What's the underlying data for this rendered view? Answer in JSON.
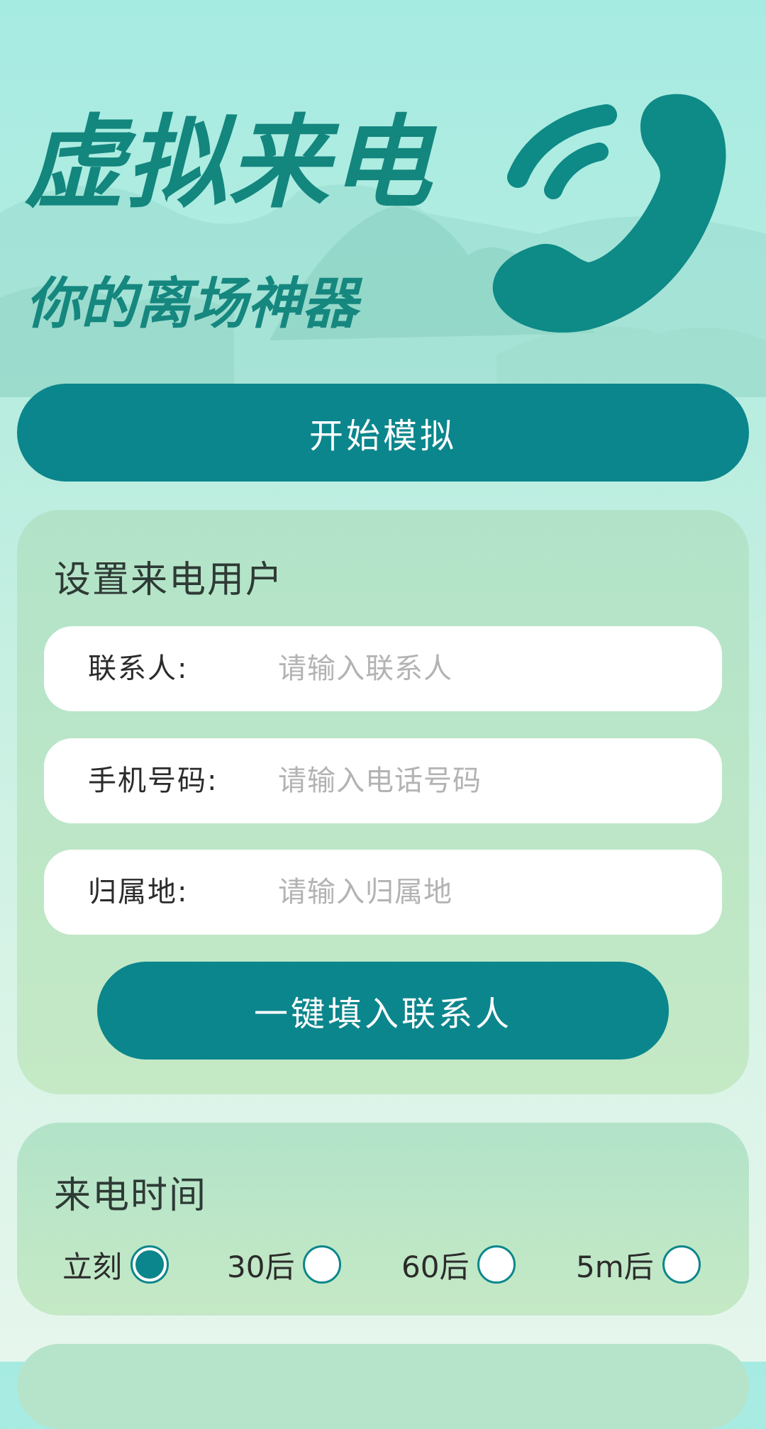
{
  "hero": {
    "title": "虚拟来电",
    "subtitle": "你的离场神器",
    "icon": "phone-icon"
  },
  "start_button": {
    "label": "开始模拟"
  },
  "caller_card": {
    "title": "设置来电用户",
    "fields": [
      {
        "label": "联系人:",
        "placeholder": "请输入联系人",
        "value": ""
      },
      {
        "label": "手机号码:",
        "placeholder": "请输入电话号码",
        "value": ""
      },
      {
        "label": "归属地:",
        "placeholder": "请输入归属地",
        "value": ""
      }
    ],
    "fill_button": {
      "label": "一键填入联系人"
    }
  },
  "time_card": {
    "title": "来电时间",
    "options": [
      {
        "label": "立刻",
        "selected": true
      },
      {
        "label": "30后",
        "selected": false
      },
      {
        "label": "60后",
        "selected": false
      },
      {
        "label": "5m后",
        "selected": false
      }
    ]
  },
  "colors": {
    "accent": "#0b868c",
    "title_green": "#13867e",
    "card_bg": "#b2e3c9"
  }
}
